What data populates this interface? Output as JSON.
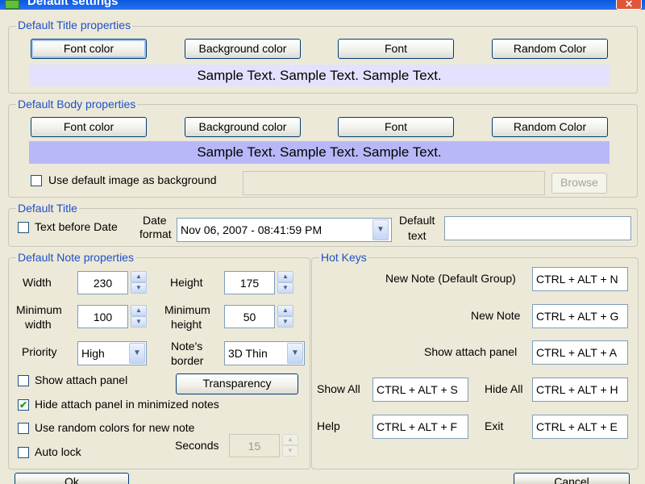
{
  "window": {
    "title": "Default settings",
    "close_glyph": "✕"
  },
  "title_props": {
    "legend": "Default Title properties",
    "buttons": [
      "Font color",
      "Background color",
      "Font",
      "Random Color"
    ],
    "sample": "Sample Text. Sample Text. Sample Text.",
    "sample_bg": "#e2e2ff"
  },
  "body_props": {
    "legend": "Default Body properties",
    "buttons": [
      "Font color",
      "Background color",
      "Font",
      "Random Color"
    ],
    "sample": "Sample Text. Sample Text. Sample Text.",
    "sample_bg": "#b8b8f8",
    "use_image_label": "Use default image as background",
    "use_image_checked": false,
    "image_path": "",
    "browse_label": "Browse"
  },
  "default_title": {
    "legend": "Default Title",
    "text_before_date_label": "Text before Date",
    "date_format_label_1": "Date",
    "date_format_label_2": "format",
    "date_format_value": "Nov 06, 2007 - 08:41:59 PM",
    "default_text_label_1": "Default",
    "default_text_label_2": "text",
    "default_text_value": ""
  },
  "note_props": {
    "legend": "Default Note properties",
    "width_label": "Width",
    "width_value": "230",
    "height_label": "Height",
    "height_value": "175",
    "min_width_label_1": "Minimum",
    "min_width_label_2": "width",
    "min_width_value": "100",
    "min_height_label_1": "Minimum",
    "min_height_label_2": "height",
    "min_height_value": "50",
    "priority_label": "Priority",
    "priority_value": "High",
    "border_label_1": "Note's",
    "border_label_2": "border",
    "border_value": "3D Thin",
    "show_attach_label": "Show attach panel",
    "transparency_label": "Transparency",
    "hide_attach_label": "Hide attach panel in minimized notes",
    "random_colors_label": "Use random colors for new note",
    "auto_lock_label": "Auto lock",
    "seconds_label": "Seconds",
    "seconds_value": "15",
    "check_glyph": "✔"
  },
  "hot_keys": {
    "legend": "Hot Keys",
    "new_note_group_label": "New Note (Default Group)",
    "new_note_group_value": "CTRL + ALT + N",
    "new_note_label": "New Note",
    "new_note_value": "CTRL + ALT + G",
    "show_attach_label": "Show attach panel",
    "show_attach_value": "CTRL + ALT + A",
    "show_all_label": "Show All",
    "show_all_value": "CTRL + ALT + S",
    "hide_all_label": "Hide All",
    "hide_all_value": "CTRL + ALT + H",
    "help_label": "Help",
    "help_value": "CTRL + ALT + F",
    "exit_label": "Exit",
    "exit_value": "CTRL + ALT + E"
  },
  "footer": {
    "ok_label": "Ok",
    "cancel_label": "Cancel"
  }
}
